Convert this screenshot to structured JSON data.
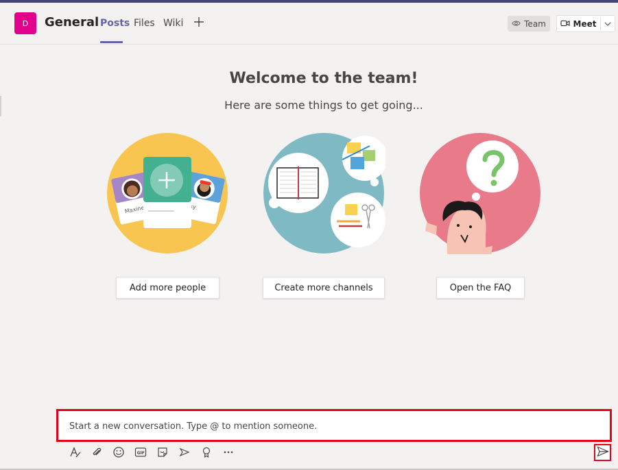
{
  "colors": {
    "brand": "#6264a7",
    "team_avatar": "#e3008c",
    "highlight": "#e3001b"
  },
  "header": {
    "team_initial": "D",
    "channel_name": "General",
    "tabs": [
      {
        "label": "Posts",
        "active": true
      },
      {
        "label": "Files",
        "active": false
      },
      {
        "label": "Wiki",
        "active": false
      }
    ],
    "team_button": {
      "label": "Team",
      "icon": "eye-icon"
    },
    "meet_button": {
      "label": "Meet",
      "icon": "video-camera-icon"
    }
  },
  "welcome": {
    "title": "Welcome to the team!",
    "subtitle": "Here are some things to get going..."
  },
  "cards": [
    {
      "button_label": "Add more people",
      "illustration": "people-cards",
      "card_names": [
        "Maxine",
        "ky"
      ]
    },
    {
      "button_label": "Create more channels",
      "illustration": "notebook-and-notes"
    },
    {
      "button_label": "Open the FAQ",
      "illustration": "question-mark-person"
    }
  ],
  "compose": {
    "placeholder": "Start a new conversation. Type @ to mention someone.",
    "toolbar": [
      "format-icon",
      "attach-icon",
      "emoji-icon",
      "gif-icon",
      "sticker-icon",
      "meet-now-icon",
      "praise-icon",
      "more-icon"
    ],
    "send_icon": "send-icon"
  }
}
